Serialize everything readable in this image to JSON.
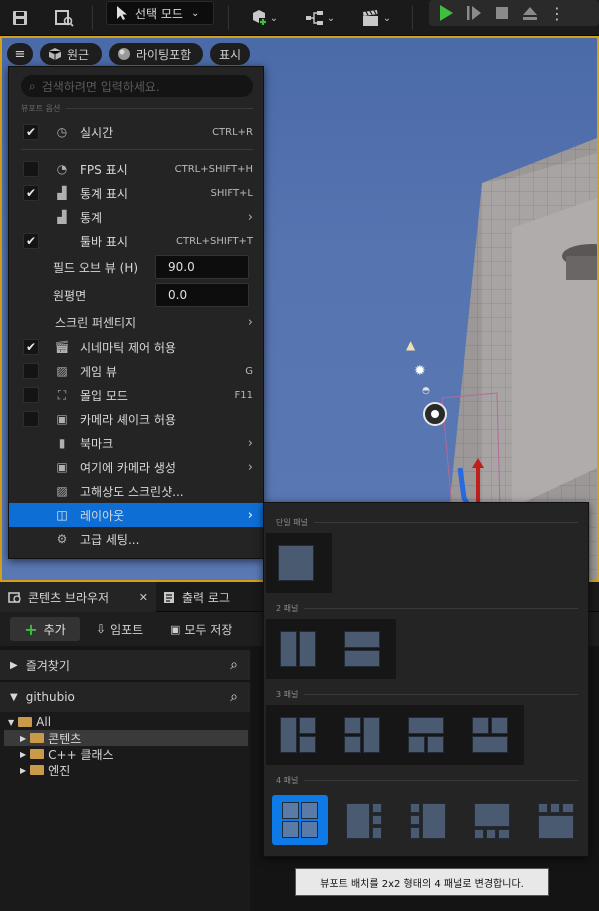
{
  "toolbar": {
    "mode_label": "선택 모드",
    "accent_play": "#3fbf3f"
  },
  "viewport": {
    "menu_button": "≡",
    "perspective_label": "원근",
    "lit_label": "라이팅포함",
    "show_label": "표시",
    "border_color": "#d4a018"
  },
  "menu": {
    "search_placeholder": "검색하려면 입력하세요.",
    "section_title": "뷰포트 옵션",
    "items": {
      "realtime": {
        "label": "실시간",
        "shortcut": "CTRL+R",
        "checked": true
      },
      "fps": {
        "label": "FPS 표시",
        "shortcut": "CTRL+SHIFT+H",
        "checked": false
      },
      "stats_show": {
        "label": "통계 표시",
        "shortcut": "SHIFT+L",
        "checked": true
      },
      "stats": {
        "label": "통계"
      },
      "toolbar_show": {
        "label": "툴바 표시",
        "shortcut": "CTRL+SHIFT+T",
        "checked": true
      },
      "fov": {
        "label": "필드 오브 뷰 (H)",
        "value": "90.0"
      },
      "far_plane": {
        "label": "원평면",
        "value": "0.0"
      },
      "screen_percentage": {
        "label": "스크린 퍼센티지"
      },
      "cinematic": {
        "label": "시네마틱 제어 허용",
        "checked": true
      },
      "game_view": {
        "label": "게임 뷰",
        "shortcut": "G",
        "checked": false
      },
      "immersive": {
        "label": "몰입 모드",
        "shortcut": "F11",
        "checked": false
      },
      "camera_shake": {
        "label": "카메라 셰이크 허용",
        "checked": false
      },
      "bookmark": {
        "label": "북마크"
      },
      "create_camera": {
        "label": "여기에 카메라 생성"
      },
      "hires_screenshot": {
        "label": "고해상도 스크린샷..."
      },
      "layout": {
        "label": "레이아웃"
      },
      "advanced": {
        "label": "고급 세팅..."
      }
    },
    "selected_color": "#0d6fd6"
  },
  "layout_menu": {
    "sections": {
      "one": "단일 패널",
      "two": "2 패널",
      "three": "3 패널",
      "four": "4 패널"
    },
    "active_layout": "2x2"
  },
  "tooltip": "뷰포트 배치를 2x2 형태의 4 패널로 변경합니다.",
  "content_browser": {
    "tab_label": "콘텐츠 브라우저",
    "output_tab_label": "출력 로그",
    "add_label": "추가",
    "import_label": "임포트",
    "save_all_label": "모두 저장",
    "favorites_label": "즐겨찾기",
    "project_label": "githubio",
    "tree": {
      "all": "All",
      "content": "콘텐츠",
      "cpp": "C++ 클래스",
      "engine": "엔진"
    }
  }
}
